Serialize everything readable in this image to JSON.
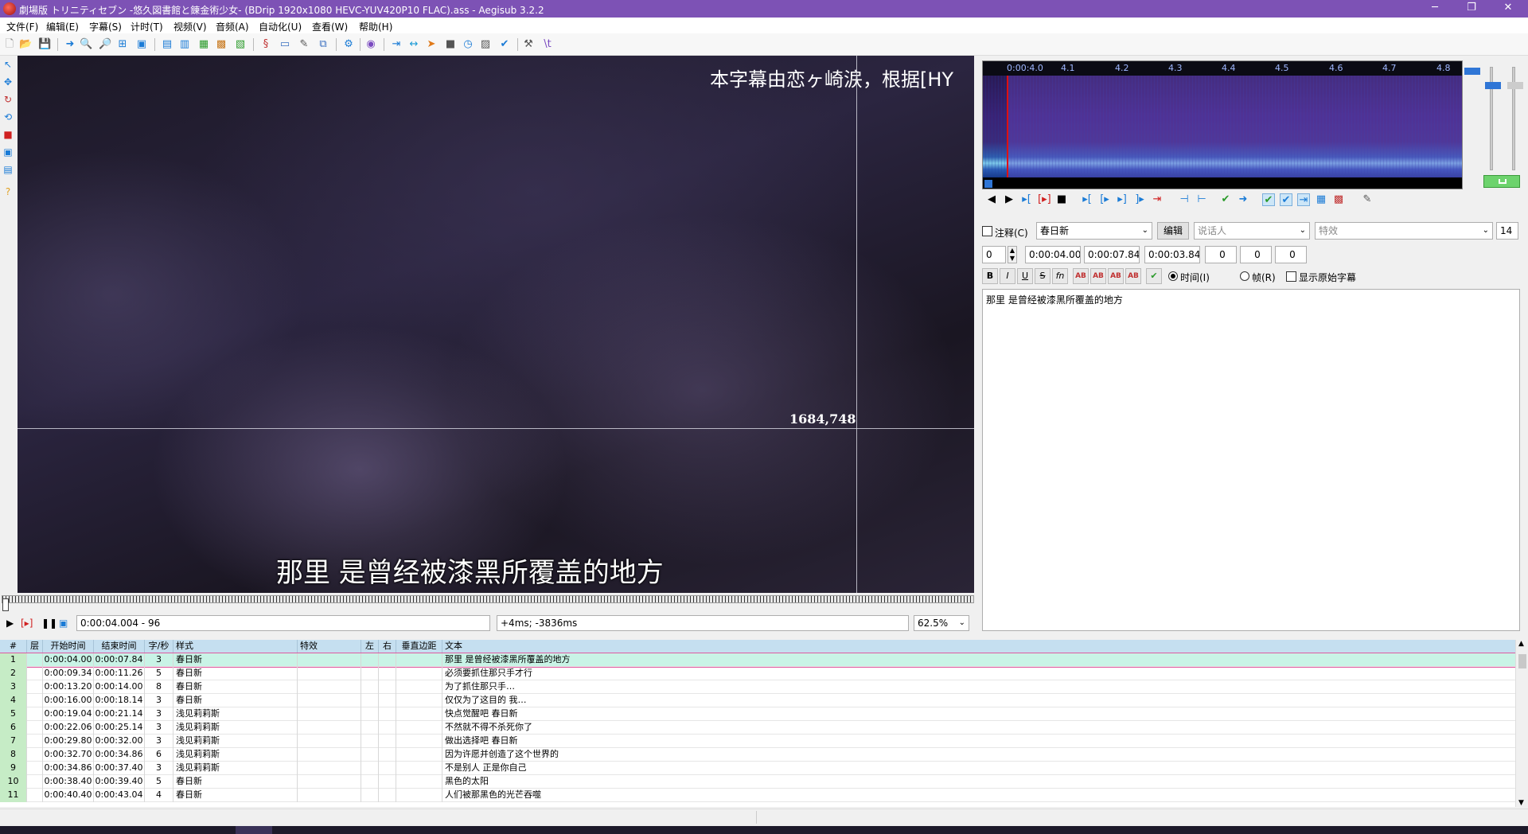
{
  "window": {
    "title": "劇場版 トリニティセブン -悠久図書館と錬金術少女- (BDrip 1920x1080 HEVC-YUV420P10 FLAC).ass - Aegisub 3.2.2"
  },
  "menu": [
    "文件(F)",
    "编辑(E)",
    "字幕(S)",
    "计时(T)",
    "视频(V)",
    "音频(A)",
    "自动化(U)",
    "查看(W)",
    "帮助(H)"
  ],
  "video": {
    "top_subtitle": "本字幕由恋ヶ崎涙，根据[HY",
    "main_subtitle": "那里 是曾经被漆黑所覆盖的地方",
    "crosshair_coords": "1684,748",
    "time_display": "0:00:04.004 - 96",
    "offset_display": "+4ms; -3836ms",
    "zoom": "62.5%"
  },
  "audio": {
    "ruler_ticks": [
      "0:00:4.0",
      "4.1",
      "4.2",
      "4.3",
      "4.4",
      "4.5",
      "4.6",
      "4.7",
      "4.8"
    ]
  },
  "edit": {
    "comment_label": "注释(C)",
    "style_value": "春日新",
    "edit_button": "编辑",
    "actor_placeholder": "说话人",
    "effect_placeholder": "特效",
    "char_count": "14",
    "layer": "0",
    "start_time": "0:00:04.00",
    "end_time": "0:00:07.84",
    "duration": "0:00:03.84",
    "margin_l": "0",
    "margin_r": "0",
    "margin_v": "0",
    "fmt_bold": "B",
    "fmt_italic": "I",
    "fmt_underline": "U",
    "fmt_strike": "S",
    "fmt_fn": "fn",
    "fmt_ab": "AB",
    "time_radio": "时间(I)",
    "frame_radio": "帧(R)",
    "show_original": "显示原始字幕",
    "text": "那里 是曾经被漆黑所覆盖的地方"
  },
  "grid": {
    "headers": [
      "#",
      "层",
      "开始时间",
      "结束时间",
      "字/秒",
      "样式",
      "特效",
      "左",
      "右",
      "垂直边距",
      "文本"
    ],
    "rows": [
      {
        "num": "1",
        "start": "0:00:04.00",
        "end": "0:00:07.84",
        "cps": "3",
        "style": "春日新",
        "text": "那里 是曾经被漆黑所覆盖的地方"
      },
      {
        "num": "2",
        "start": "0:00:09.34",
        "end": "0:00:11.26",
        "cps": "5",
        "style": "春日新",
        "text": "必须要抓住那只手才行"
      },
      {
        "num": "3",
        "start": "0:00:13.20",
        "end": "0:00:14.00",
        "cps": "8",
        "style": "春日新",
        "text": "为了抓住那只手…"
      },
      {
        "num": "4",
        "start": "0:00:16.00",
        "end": "0:00:18.14",
        "cps": "3",
        "style": "春日新",
        "text": "仅仅为了这目的 我…"
      },
      {
        "num": "5",
        "start": "0:00:19.04",
        "end": "0:00:21.14",
        "cps": "3",
        "style": "浅见莉莉斯",
        "text": "快点觉醒吧 春日新"
      },
      {
        "num": "6",
        "start": "0:00:22.06",
        "end": "0:00:25.14",
        "cps": "3",
        "style": "浅见莉莉斯",
        "text": "不然就不得不杀死你了"
      },
      {
        "num": "7",
        "start": "0:00:29.80",
        "end": "0:00:32.00",
        "cps": "3",
        "style": "浅见莉莉斯",
        "text": "做出选择吧 春日新"
      },
      {
        "num": "8",
        "start": "0:00:32.70",
        "end": "0:00:34.86",
        "cps": "6",
        "style": "浅见莉莉斯",
        "text": "因为许愿并创造了这个世界的"
      },
      {
        "num": "9",
        "start": "0:00:34.86",
        "end": "0:00:37.40",
        "cps": "3",
        "style": "浅见莉莉斯",
        "text": "不是别人 正是你自己"
      },
      {
        "num": "10",
        "start": "0:00:38.40",
        "end": "0:00:39.40",
        "cps": "5",
        "style": "春日新",
        "text": "黑色的太阳"
      },
      {
        "num": "11",
        "start": "0:00:40.40",
        "end": "0:00:43.04",
        "cps": "4",
        "style": "春日新",
        "text": "人们被那黑色的光芒吞噬"
      }
    ]
  },
  "colors": {
    "titlebar": "#7d52b5",
    "grid_header": "#c5dff0",
    "grid_rownum": "#c6ecc6",
    "grid_active": "#c9f3e6",
    "audio_cursor": "#e01010"
  }
}
